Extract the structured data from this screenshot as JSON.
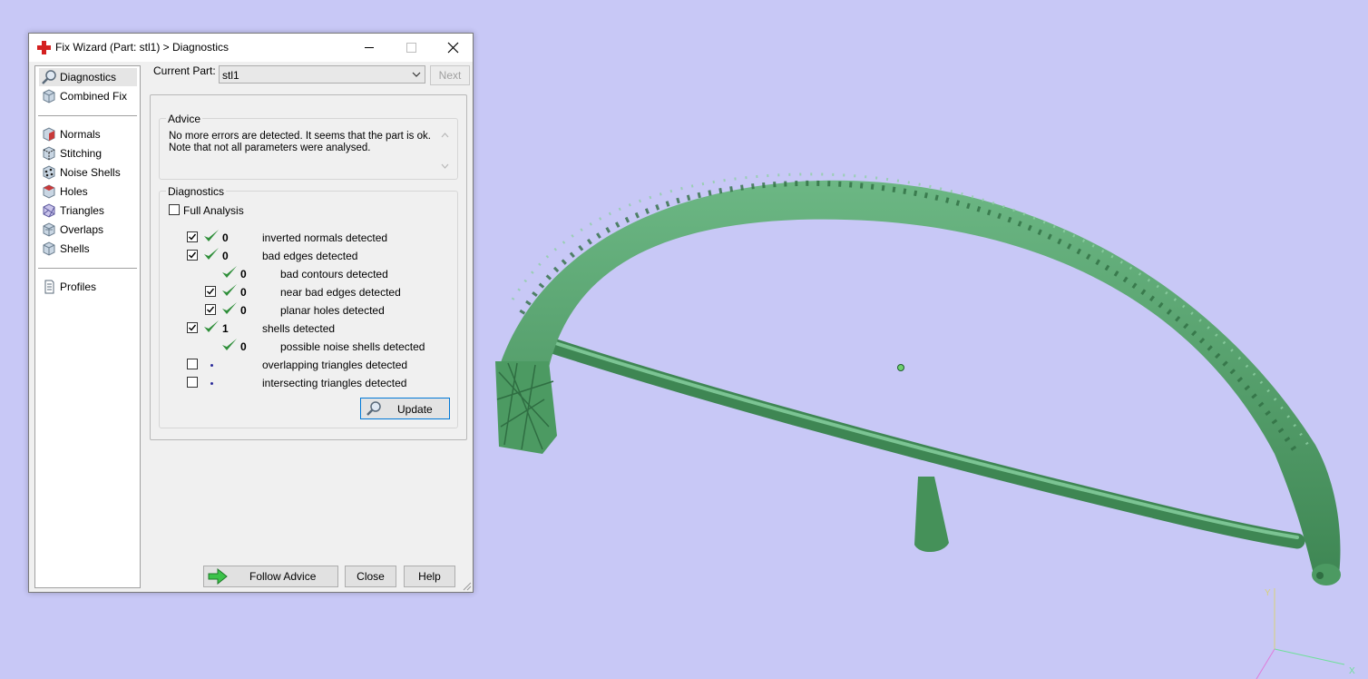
{
  "window": {
    "title": "Fix Wizard (Part: stl1) > Diagnostics"
  },
  "sidebar": {
    "items": [
      {
        "label": "Diagnostics",
        "icon": "magnifier-icon"
      },
      {
        "label": "Combined Fix",
        "icon": "cube-icon"
      },
      {
        "label": "Normals",
        "icon": "normals-cube-icon"
      },
      {
        "label": "Stitching",
        "icon": "stitching-cube-icon"
      },
      {
        "label": "Noise Shells",
        "icon": "noise-shells-icon"
      },
      {
        "label": "Holes",
        "icon": "holes-cube-icon"
      },
      {
        "label": "Triangles",
        "icon": "triangles-cube-icon"
      },
      {
        "label": "Overlaps",
        "icon": "overlaps-cube-icon"
      },
      {
        "label": "Shells",
        "icon": "shells-cube-icon"
      },
      {
        "label": "Profiles",
        "icon": "document-icon"
      }
    ]
  },
  "current_part": {
    "label": "Current Part:",
    "value": "stl1"
  },
  "next_button": "Next",
  "advice": {
    "title": "Advice",
    "text": "No more errors are detected. It seems that the part is ok.\nNote that not all parameters were analysed."
  },
  "diagnostics": {
    "title": "Diagnostics",
    "full_analysis_label": "Full Analysis",
    "full_analysis_checked": false,
    "rows": [
      {
        "checked": true,
        "status": "ok",
        "count": "0",
        "label": "inverted normals detected"
      },
      {
        "checked": true,
        "status": "ok",
        "count": "0",
        "label": "bad edges detected"
      },
      {
        "checked": null,
        "status": "ok",
        "count": "0",
        "label": "bad contours detected"
      },
      {
        "checked": true,
        "status": "ok",
        "count": "0",
        "label": "near bad edges detected"
      },
      {
        "checked": true,
        "status": "ok",
        "count": "0",
        "label": "planar holes detected"
      },
      {
        "checked": true,
        "status": "ok",
        "count": "1",
        "label": "shells detected"
      },
      {
        "checked": null,
        "status": "ok",
        "count": "0",
        "label": "possible noise shells detected"
      },
      {
        "checked": false,
        "status": "pending",
        "count": "",
        "label": "overlapping triangles detected"
      },
      {
        "checked": false,
        "status": "pending",
        "count": "",
        "label": "intersecting triangles detected"
      }
    ],
    "update_button": "Update"
  },
  "footer": {
    "follow_advice": "Follow Advice",
    "close": "Close",
    "help": "Help"
  },
  "scene": {
    "background": "#c8c8f6",
    "model_color": "#4f9f67",
    "axis_labels": {
      "y": "Y",
      "x": "X"
    }
  }
}
